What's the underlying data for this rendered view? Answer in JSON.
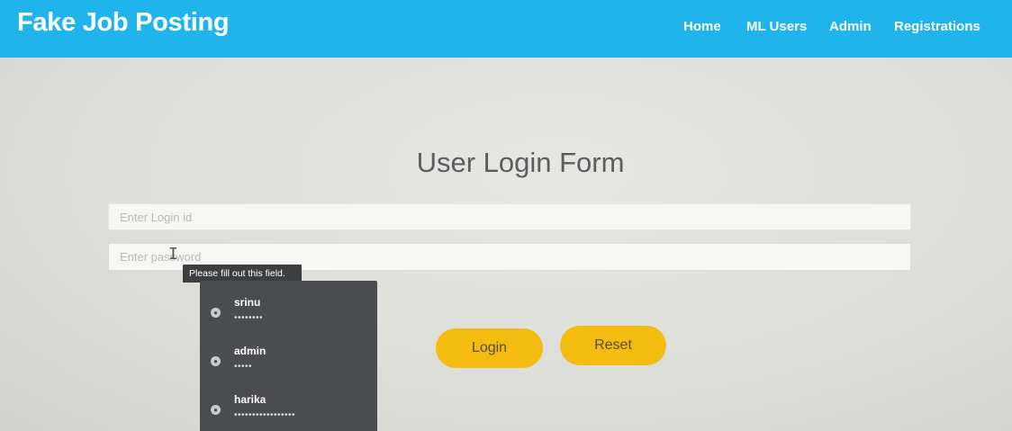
{
  "navbar": {
    "brand": "Fake Job Posting",
    "links": [
      "Home",
      "ML Users",
      "Admin",
      "Registrations"
    ]
  },
  "form": {
    "title": "User Login Form",
    "login_placeholder": "Enter Login id",
    "password_placeholder": "Enter password",
    "validation_tooltip": "Please fill out this field.",
    "login_label": "Login",
    "reset_label": "Reset"
  },
  "autofill": {
    "items": [
      {
        "username": "srinu",
        "password_mask": "••••••••",
        "icon": "key-icon"
      },
      {
        "username": "admin",
        "password_mask": "•••••",
        "icon": "key-icon"
      },
      {
        "username": "harika",
        "password_mask": "•••••••••••••••••",
        "icon": "key-icon"
      }
    ]
  },
  "colors": {
    "navbar": "#1fb4ec",
    "button": "#f4bb10",
    "autofill_bg": "#4a4c4f"
  }
}
